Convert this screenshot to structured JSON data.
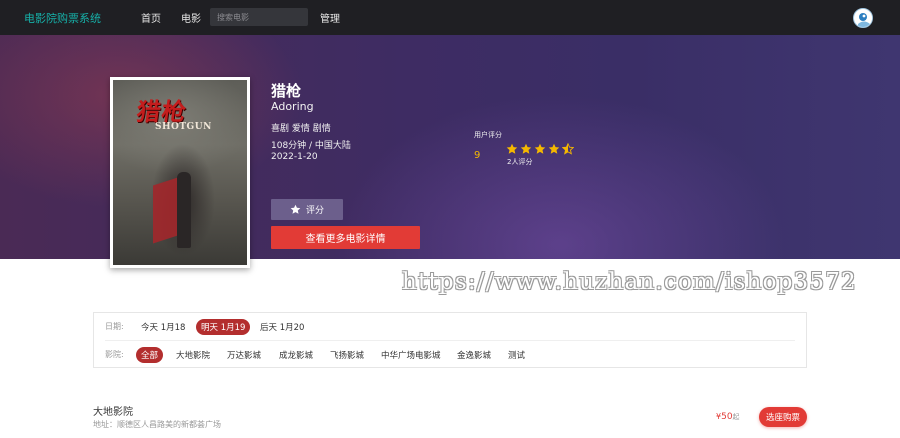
{
  "nav": {
    "brand": "电影院购票系统",
    "home": "首页",
    "movie": "电影",
    "search_placeholder": "搜索电影",
    "manage": "管理"
  },
  "movie": {
    "poster_title": "猎枪",
    "poster_subtitle": "SHOTGUN",
    "title": "猎枪",
    "english_title": "Adoring",
    "genres": "喜剧 爱情 剧情",
    "duration_region": "108分钟 / 中国大陆",
    "release_date": "2022-1-20"
  },
  "rating": {
    "label": "用户评分",
    "score": "9",
    "stars": 4.5,
    "count": "2人评分"
  },
  "actions": {
    "rate": "评分",
    "more": "查看更多电影详情"
  },
  "watermark": "https://www.huzhan.com/ishop3572",
  "filter": {
    "date_label": "日期:",
    "dates": [
      "今天 1月18",
      "明天 1月19",
      "后天 1月20"
    ],
    "active_date": "明天 1月19",
    "cinema_label": "影院:",
    "cinemas": [
      "全部",
      "大地影院",
      "万达影城",
      "成龙影城",
      "飞扬影城",
      "中华广场电影城",
      "金逸影城",
      "测试"
    ],
    "active_cinema": "全部"
  },
  "cinema": {
    "name": "大地影院",
    "address": "地址：顺德区人昌路美的新都荟广场",
    "price_symbol": "¥",
    "price": "50",
    "price_suffix": "起",
    "buy": "选座购票"
  },
  "colors": {
    "accent": "#e23b36",
    "brand": "#16b0a8",
    "active_pill": "#b32e2e",
    "star": "#f5b800",
    "nav_bg": "#1f1f23"
  }
}
